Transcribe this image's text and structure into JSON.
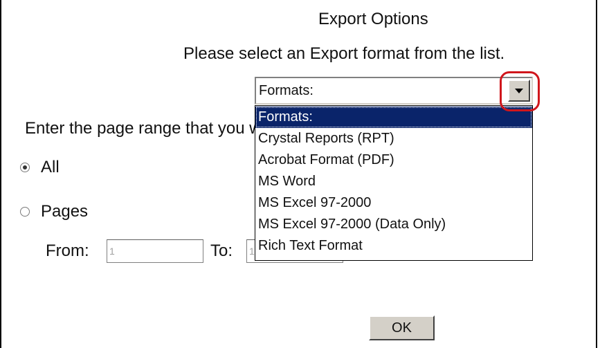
{
  "dialog": {
    "title": "Export Options",
    "instruction": "Please select an Export format from the list."
  },
  "format_select": {
    "selected": "Formats:",
    "options": [
      "Formats:",
      "Crystal Reports (RPT)",
      "Acrobat Format (PDF)",
      "MS Word",
      "MS Excel 97-2000",
      "MS Excel 97-2000 (Data Only)",
      "Rich Text Format"
    ],
    "highlighted_index": 0
  },
  "page_range": {
    "label": "Enter the page range that you want to export.",
    "all_label": "All",
    "pages_label": "Pages",
    "selected_option": "All",
    "from_label": "From:",
    "from_value": "1",
    "to_label": "To:",
    "to_value": "1"
  },
  "actions": {
    "ok_label": "OK"
  },
  "colors": {
    "selection_bg": "#0a246a",
    "highlight_ring": "#d0161c",
    "button_face": "#d4d0c8"
  },
  "icons": {
    "dropdown_arrow": "chevron-down-icon"
  }
}
